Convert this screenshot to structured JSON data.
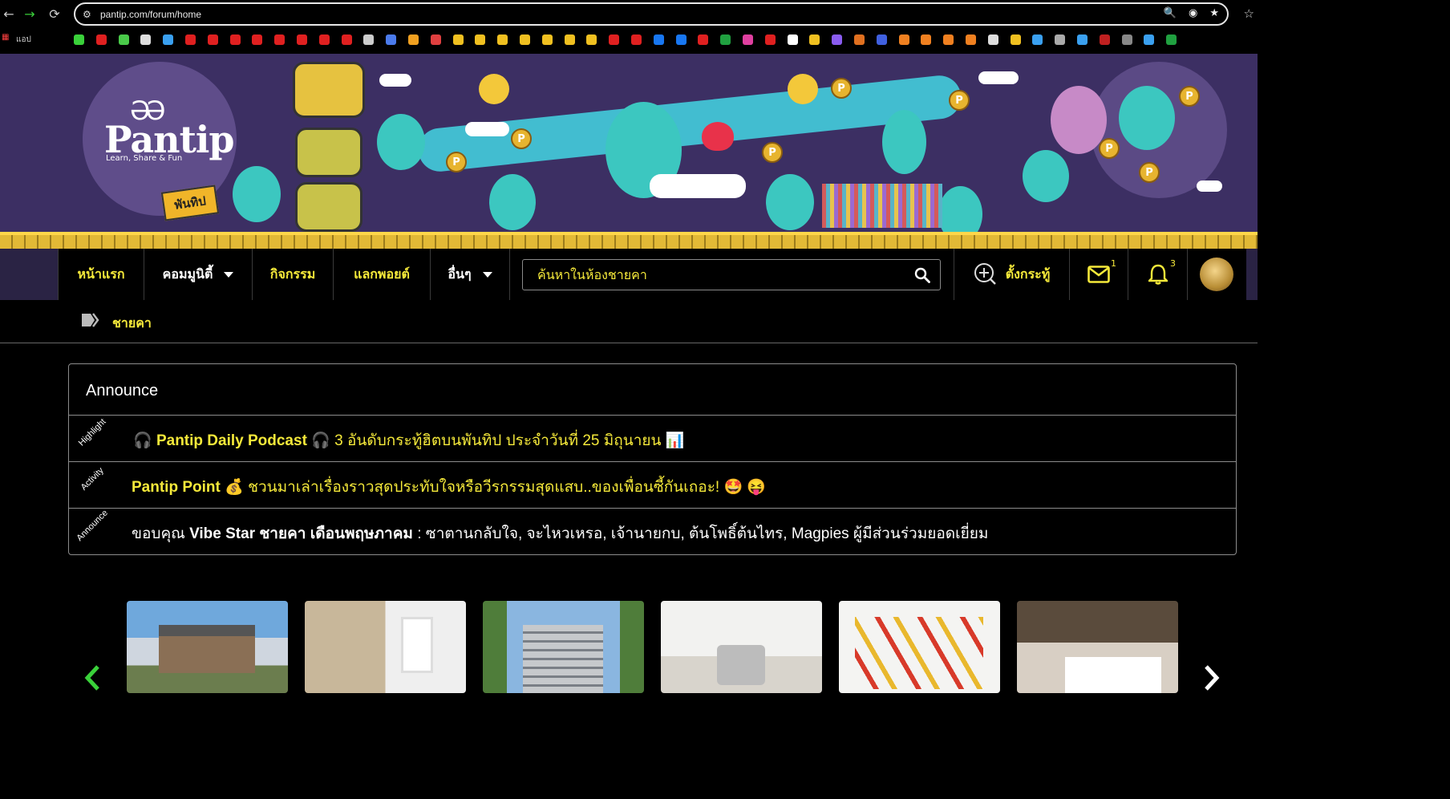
{
  "browser": {
    "url": "pantip.com/forum/home",
    "bookmarks_label": "แอป"
  },
  "banner": {
    "logo_name": "Pantip",
    "logo_tagline": "Learn, Share & Fun",
    "sign_text": "พันทิป"
  },
  "nav": {
    "home": "หน้าแรก",
    "community": "คอมมูนิตี้",
    "activity": "กิจกรรม",
    "exchange_points": "แลกพอยต์",
    "other": "อื่นๆ",
    "search_placeholder": "ค้นหาในห้องชายคา",
    "new_topic": "ตั้งกระทู้",
    "messages_count": "1",
    "notifications_count": "3"
  },
  "breadcrumb": {
    "label": "ชายคา"
  },
  "announce": {
    "title": "Announce",
    "rows": [
      {
        "tag": "Highlight",
        "prefix_icon": "🎧",
        "title": "Pantip Daily Podcast",
        "mid_icon": "🎧",
        "text": "3 อันดับกระทู้ฮิตบนพันทิป ประจำวันที่ 25 มิถุนายน",
        "suffix_icon": "📊"
      },
      {
        "tag": "Activity",
        "title": "Pantip Point",
        "mid_icon": "💰",
        "text": "ชวนมาเล่าเรื่องราวสุดประทับใจหรือวีรกรรมสุดแสบ..ของเพื่อนซี้กันเถอะ!",
        "suffix_icon": "🤩 😝"
      },
      {
        "tag": "Announce",
        "lead": "ขอบคุณ",
        "bold": "Vibe Star ชายคา เดือนพฤษภาคม",
        "text": ": ซาตานกลับใจ, จะไหวเหรอ, เจ้านายกบ, ต้นโพธิ์ต้นไทร, Magpies ผู้มีส่วนร่วมยอดเยี่ยม"
      }
    ]
  },
  "carousel": {
    "cards": [
      "house",
      "room-renovation",
      "condo-building",
      "kitchen",
      "diy-tools",
      "bedroom"
    ]
  },
  "colors": {
    "accent": "#f5e93a",
    "background": "#000000",
    "carousel_arrow_left": "#3ad13a",
    "carousel_arrow_right": "#ffffff"
  }
}
